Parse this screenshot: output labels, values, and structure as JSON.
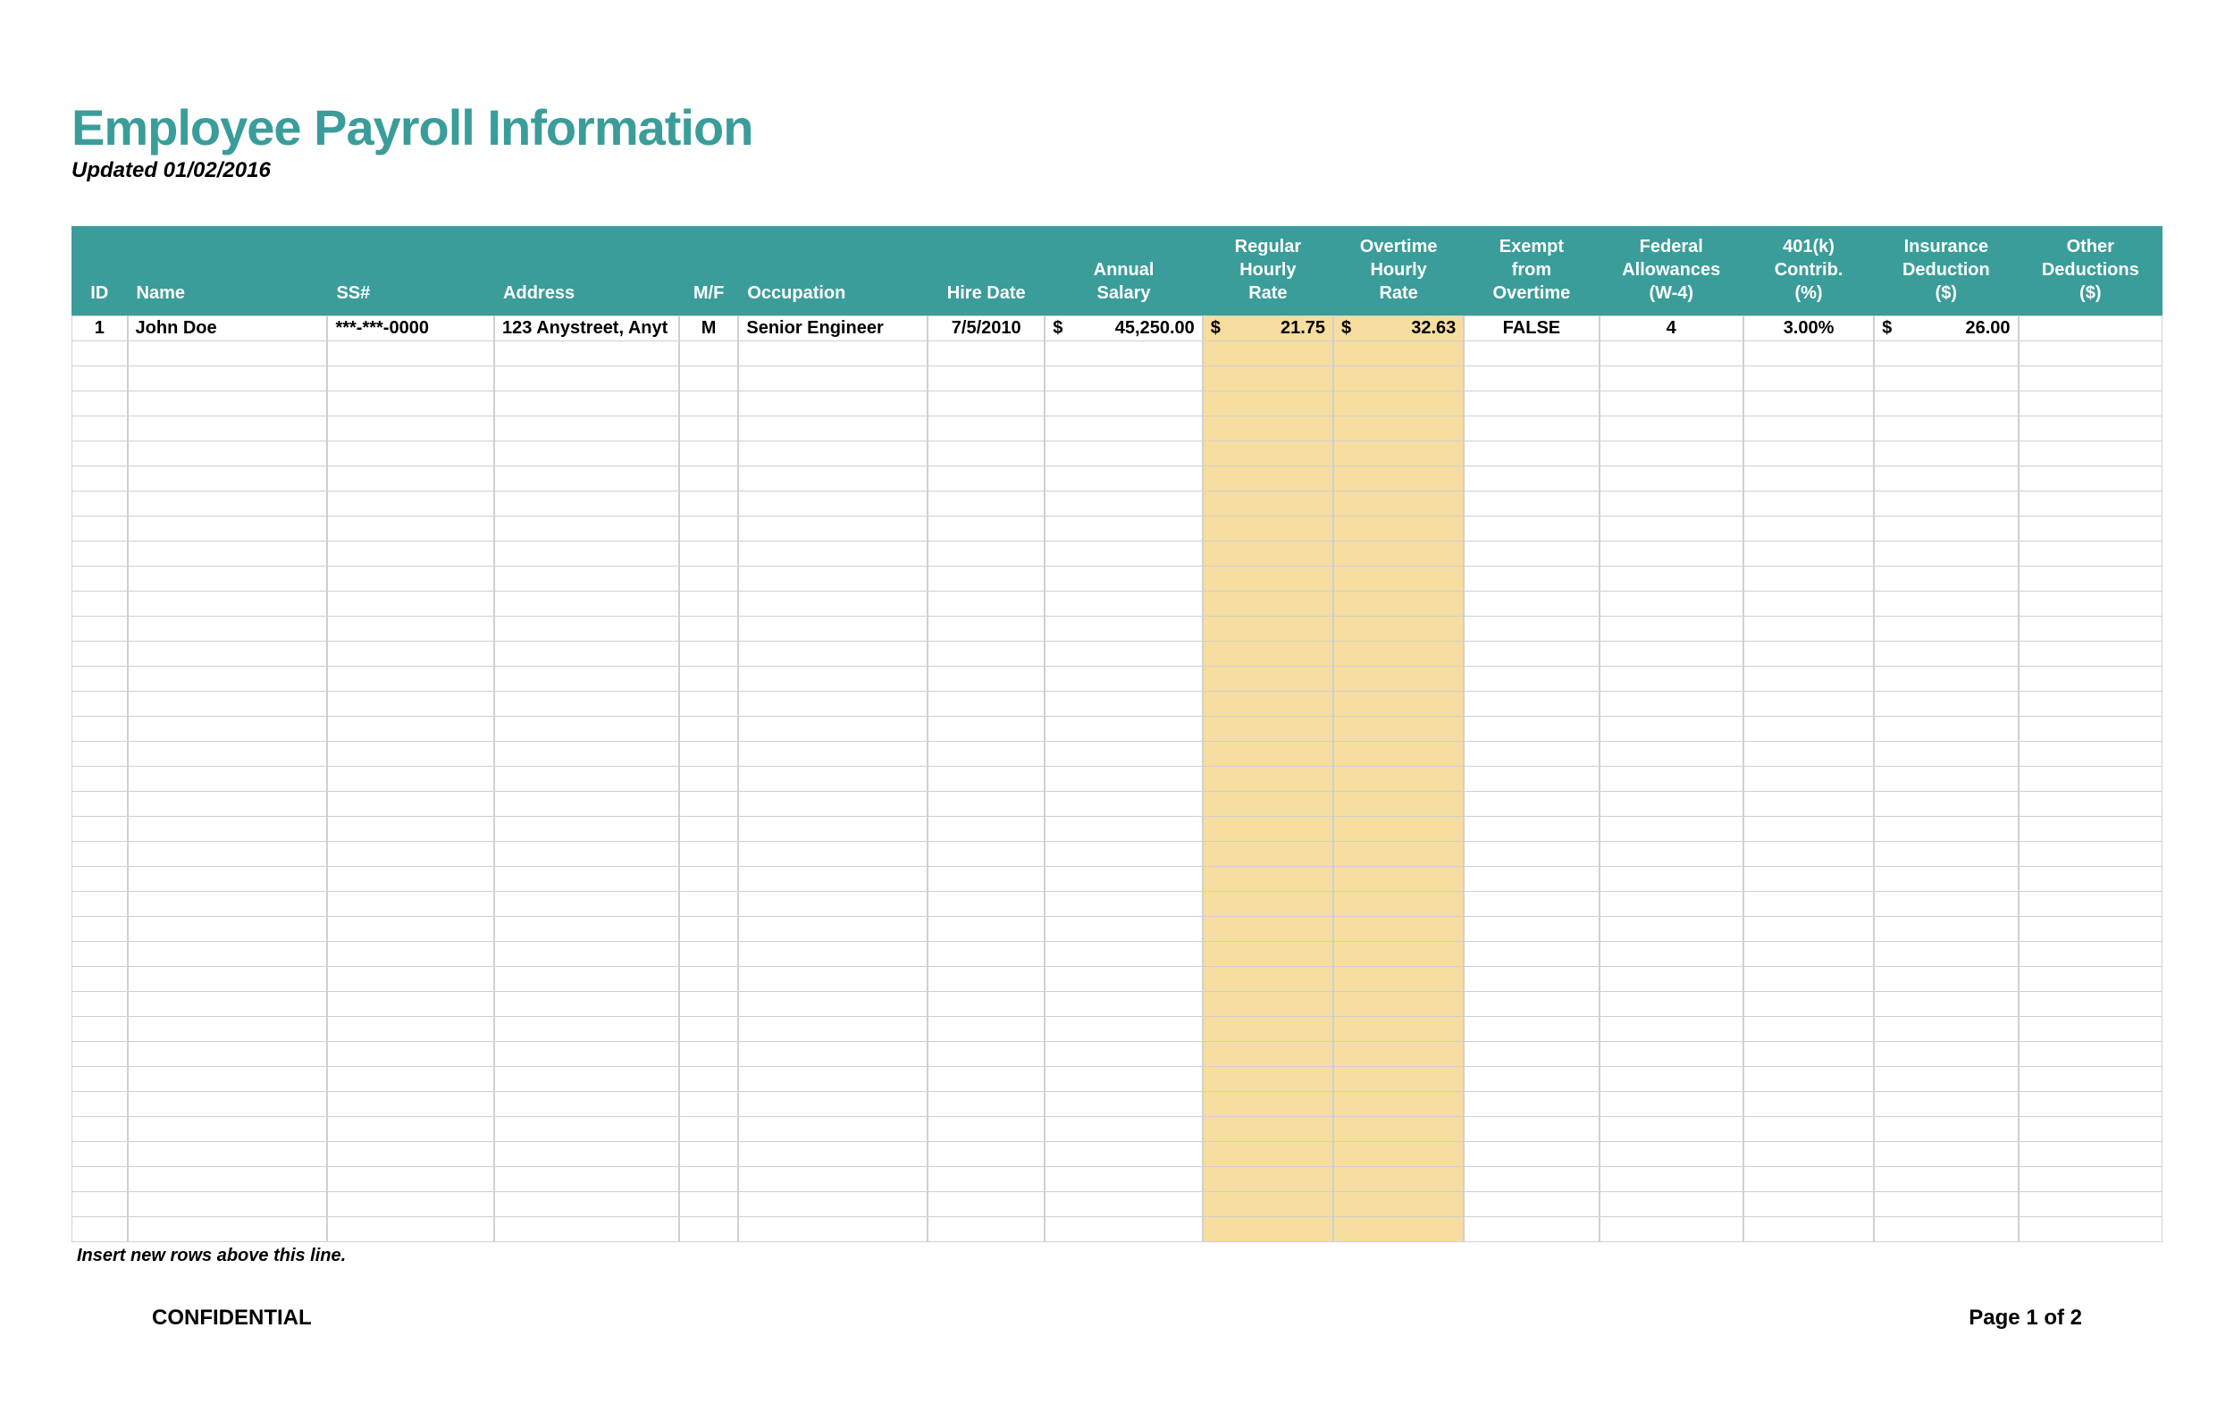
{
  "header": {
    "title": "Employee Payroll Information",
    "updated": "Updated 01/02/2016"
  },
  "columns": [
    {
      "key": "id",
      "label": "ID",
      "align": "center",
      "width": "c-id"
    },
    {
      "key": "name",
      "label": "Name",
      "align": "left",
      "width": "c-name"
    },
    {
      "key": "ss",
      "label": "SS#",
      "align": "left",
      "width": "c-ss"
    },
    {
      "key": "address",
      "label": "Address",
      "align": "left",
      "width": "c-addr"
    },
    {
      "key": "mf",
      "label": "M/F",
      "align": "center",
      "width": "c-mf"
    },
    {
      "key": "occupation",
      "label": "Occupation",
      "align": "left",
      "width": "c-occ"
    },
    {
      "key": "hire_date",
      "label": "Hire Date",
      "align": "center",
      "width": "c-hire"
    },
    {
      "key": "annual_salary",
      "label": "Annual\nSalary",
      "align": "center",
      "width": "c-sal",
      "currency": true
    },
    {
      "key": "reg_rate",
      "label": "Regular\nHourly\nRate",
      "align": "center",
      "width": "c-reg",
      "currency": true,
      "highlight": true
    },
    {
      "key": "ot_rate",
      "label": "Overtime\nHourly\nRate",
      "align": "center",
      "width": "c-ot",
      "currency": true,
      "highlight": true
    },
    {
      "key": "exempt",
      "label": "Exempt\nfrom\nOvertime",
      "align": "center",
      "width": "c-ex"
    },
    {
      "key": "fed_allow",
      "label": "Federal\nAllowances\n(W-4)",
      "align": "center",
      "width": "c-fed"
    },
    {
      "key": "k401",
      "label": "401(k)\nContrib.\n(%)",
      "align": "center",
      "width": "c-401"
    },
    {
      "key": "ins_ded",
      "label": "Insurance\nDeduction\n($)",
      "align": "center",
      "width": "c-ins",
      "currency": true
    },
    {
      "key": "other_ded",
      "label": "Other\nDeductions\n($)",
      "align": "center",
      "width": "c-oth"
    }
  ],
  "rows": [
    {
      "id": "1",
      "name": "John Doe",
      "ss": "***-***-0000",
      "address": "123 Anystreet, Anyt",
      "mf": "M",
      "occupation": "Senior Engineer",
      "hire_date": "7/5/2010",
      "annual_salary": "45,250.00",
      "reg_rate": "21.75",
      "ot_rate": "32.63",
      "exempt": "FALSE",
      "fed_allow": "4",
      "k401": "3.00%",
      "ins_ded": "26.00",
      "other_ded": ""
    }
  ],
  "empty_row_count": 36,
  "footer_note": "Insert new rows above this line.",
  "page_footer": {
    "left": "CONFIDENTIAL",
    "right": "Page 1 of 2"
  },
  "colors": {
    "header_bg": "#3a9d9a",
    "highlight_bg": "#f5dea0"
  }
}
